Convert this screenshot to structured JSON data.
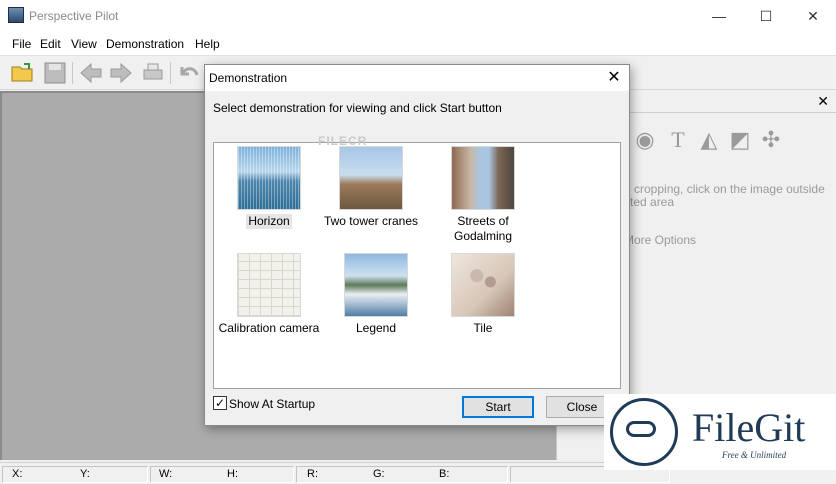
{
  "window": {
    "title": "Perspective Pilot",
    "controls": {
      "minimize": "—",
      "maximize": "☐",
      "close": "✕"
    }
  },
  "menu": [
    "File",
    "Edit",
    "View",
    "Demonstration",
    "Help"
  ],
  "toolbar_icons": [
    "open-folder-icon",
    "save-icon",
    "back-arrow-icon",
    "forward-arrow-icon",
    "print-icon",
    "undo-icon"
  ],
  "right_panel": {
    "close": "✕",
    "tools": [
      "circle-tool-icon",
      "text-tool-icon",
      "scale-tool-icon",
      "crop-tool-icon",
      "pin-tool-icon"
    ],
    "tool_glyphs": [
      "◉",
      "T",
      "◭",
      "◩",
      "✣"
    ],
    "hint_line1": "e cropping, click on the image outside",
    "hint_line2": "cted area",
    "more_options": "More Options"
  },
  "status": {
    "x": "X:",
    "y": "Y:",
    "w": "W:",
    "h": "H:",
    "r": "R:",
    "g": "G:",
    "b": "B:"
  },
  "dialog": {
    "title": "Demonstration",
    "close": "✕",
    "instruction": "Select demonstration for viewing and click Start button",
    "items": [
      {
        "label": "Horizon"
      },
      {
        "label": "Two tower cranes"
      },
      {
        "label": "Streets of Godalming"
      },
      {
        "label": "Calibration camera"
      },
      {
        "label": "Legend"
      },
      {
        "label": "Tile"
      }
    ],
    "show_at_startup_label": "Show At Startup",
    "show_at_startup_checked": "✓",
    "start_label": "Start",
    "close_label": "Close"
  },
  "watermarks": {
    "filecr": "FILECR",
    "filegit_name": "FileGit",
    "filegit_tag": "Free & Unlimited"
  }
}
